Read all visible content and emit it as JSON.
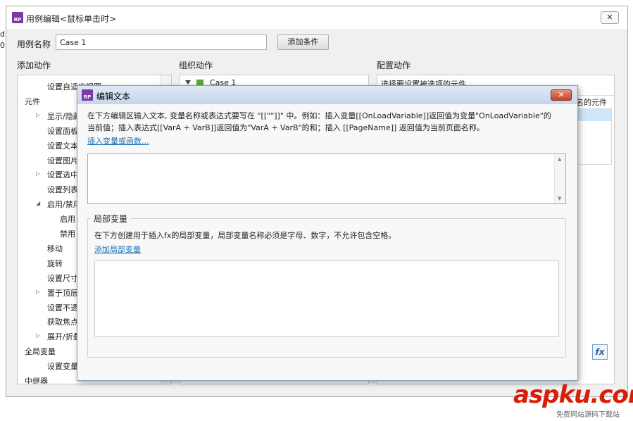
{
  "outer": {
    "title": "用例编辑<鼠标单击时>",
    "close": "✕",
    "case_name_label": "用例名称",
    "case_name_value": "Case 1",
    "add_condition": "添加条件",
    "col_add_action": "添加动作",
    "col_organize": "组织动作",
    "col_config": "配置动作",
    "config_hint": "选择要设置被选项的元件",
    "config_hint2": "名的元件",
    "organize_case": "Case 1",
    "left_edge_chars": [
      "d",
      "0"
    ]
  },
  "tree": [
    {
      "label": "设置自适应视图",
      "indent": 2,
      "arrow": ""
    },
    {
      "label": "元件",
      "indent": 1,
      "arrow": "down"
    },
    {
      "label": "显示/隐藏",
      "indent": 2,
      "arrow": "right"
    },
    {
      "label": "设置面板状态",
      "indent": 2,
      "arrow": ""
    },
    {
      "label": "设置文本",
      "indent": 2,
      "arrow": ""
    },
    {
      "label": "设置图片",
      "indent": 2,
      "arrow": ""
    },
    {
      "label": "设置选中",
      "indent": 2,
      "arrow": "right"
    },
    {
      "label": "设置列表选中项",
      "indent": 2,
      "arrow": ""
    },
    {
      "label": "启用/禁用",
      "indent": 2,
      "arrow": "down"
    },
    {
      "label": "启用",
      "indent": 3,
      "arrow": ""
    },
    {
      "label": "禁用",
      "indent": 3,
      "arrow": ""
    },
    {
      "label": "移动",
      "indent": 2,
      "arrow": ""
    },
    {
      "label": "旋转",
      "indent": 2,
      "arrow": ""
    },
    {
      "label": "设置尺寸",
      "indent": 2,
      "arrow": ""
    },
    {
      "label": "置于顶层/底层",
      "indent": 2,
      "arrow": "right"
    },
    {
      "label": "设置不透明",
      "indent": 2,
      "arrow": ""
    },
    {
      "label": "获取焦点",
      "indent": 2,
      "arrow": ""
    },
    {
      "label": "展开/折叠树节点",
      "indent": 2,
      "arrow": "right"
    },
    {
      "label": "全局变量",
      "indent": 1,
      "arrow": "down"
    },
    {
      "label": "设置变量值",
      "indent": 2,
      "arrow": ""
    },
    {
      "label": "中继器",
      "indent": 1,
      "arrow": "down"
    }
  ],
  "dialog": {
    "title": "编辑文本",
    "close": "✕",
    "desc_line1": "在下方编辑区输入文本, 变量名称或表达式要写在 \"[[\"\"]]\" 中。例如：插入变量[[OnLoadVariable]]返回值为变量\"OnLoadVariable\"的",
    "desc_line2": "当前值；插入表达式[[VarA + VarB]]返回值为\"VarA + VarB\"的和；插入 [[PageName]] 返回值为当前页面名称。",
    "insert_link": "插入变量或函数...",
    "local_vars_title": "局部变量",
    "local_vars_desc": "在下方创建用于插入fx的局部变量，局部变量名称必须是字母、数字，不允许包含空格。",
    "add_local_var": "添加局部变量"
  },
  "fx_label": "fx",
  "watermark": {
    "text": "aspku.com",
    "sub": "免费网站源码下载站"
  }
}
